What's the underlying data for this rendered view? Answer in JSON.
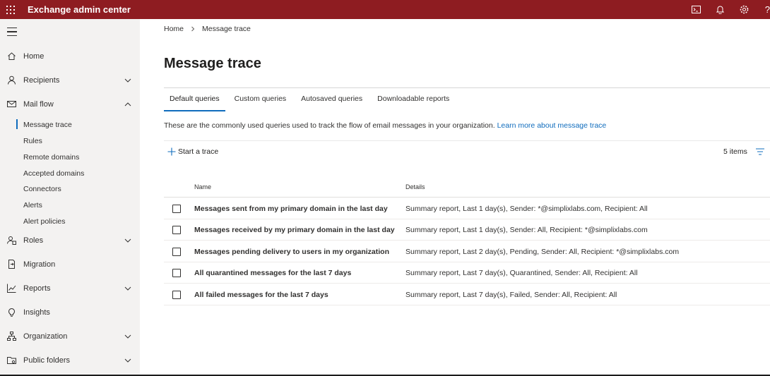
{
  "app": {
    "title": "Exchange admin center"
  },
  "topbar": {
    "icons": [
      "terminal-icon",
      "bell-icon",
      "gear-icon",
      "help-icon"
    ],
    "help_glyph": "?"
  },
  "sidebar": {
    "items": [
      {
        "label": "Home",
        "icon": "home-icon"
      },
      {
        "label": "Recipients",
        "icon": "person-icon",
        "expand": "down"
      },
      {
        "label": "Mail flow",
        "icon": "mail-icon",
        "expand": "up"
      },
      {
        "label": "Roles",
        "icon": "roles-icon",
        "expand": "down"
      },
      {
        "label": "Migration",
        "icon": "migration-icon"
      },
      {
        "label": "Reports",
        "icon": "chart-icon",
        "expand": "down"
      },
      {
        "label": "Insights",
        "icon": "lightbulb-icon"
      },
      {
        "label": "Organization",
        "icon": "org-icon",
        "expand": "down"
      },
      {
        "label": "Public folders",
        "icon": "folder-icon",
        "expand": "down"
      }
    ],
    "mailflow_sub": [
      {
        "label": "Message trace",
        "active": true
      },
      {
        "label": "Rules"
      },
      {
        "label": "Remote domains"
      },
      {
        "label": "Accepted domains"
      },
      {
        "label": "Connectors"
      },
      {
        "label": "Alerts"
      },
      {
        "label": "Alert policies"
      }
    ]
  },
  "breadcrumb": {
    "home": "Home",
    "current": "Message trace"
  },
  "page": {
    "title": "Message trace"
  },
  "tabs": [
    {
      "label": "Default queries",
      "active": true
    },
    {
      "label": "Custom queries"
    },
    {
      "label": "Autosaved queries"
    },
    {
      "label": "Downloadable reports"
    }
  ],
  "description": {
    "text": "These are the commonly used queries used to track the flow of email messages in your organization.",
    "link": "Learn more about message trace"
  },
  "commands": {
    "start_trace": "Start a trace",
    "count": "5 items"
  },
  "table": {
    "headers": {
      "name": "Name",
      "details": "Details"
    },
    "rows": [
      {
        "name": "Messages sent from my primary domain in the last day",
        "details": "Summary report, Last 1 day(s), Sender: *@simplixlabs.com, Recipient: All"
      },
      {
        "name": "Messages received by my primary domain in the last day",
        "details": "Summary report, Last 1 day(s), Sender: All, Recipient: *@simplixlabs.com"
      },
      {
        "name": "Messages pending delivery to users in my organization",
        "details": "Summary report, Last 2 day(s), Pending, Sender: All, Recipient: *@simplixlabs.com"
      },
      {
        "name": "All quarantined messages for the last 7 days",
        "details": "Summary report, Last 7 day(s), Quarantined, Sender: All, Recipient: All"
      },
      {
        "name": "All failed messages for the last 7 days",
        "details": "Summary report, Last 7 day(s), Failed, Sender: All, Recipient: All"
      }
    ]
  },
  "colors": {
    "topbar": "#8e1c21",
    "accent": "#0f6cbd",
    "sidebar": "#f3f2f1"
  }
}
